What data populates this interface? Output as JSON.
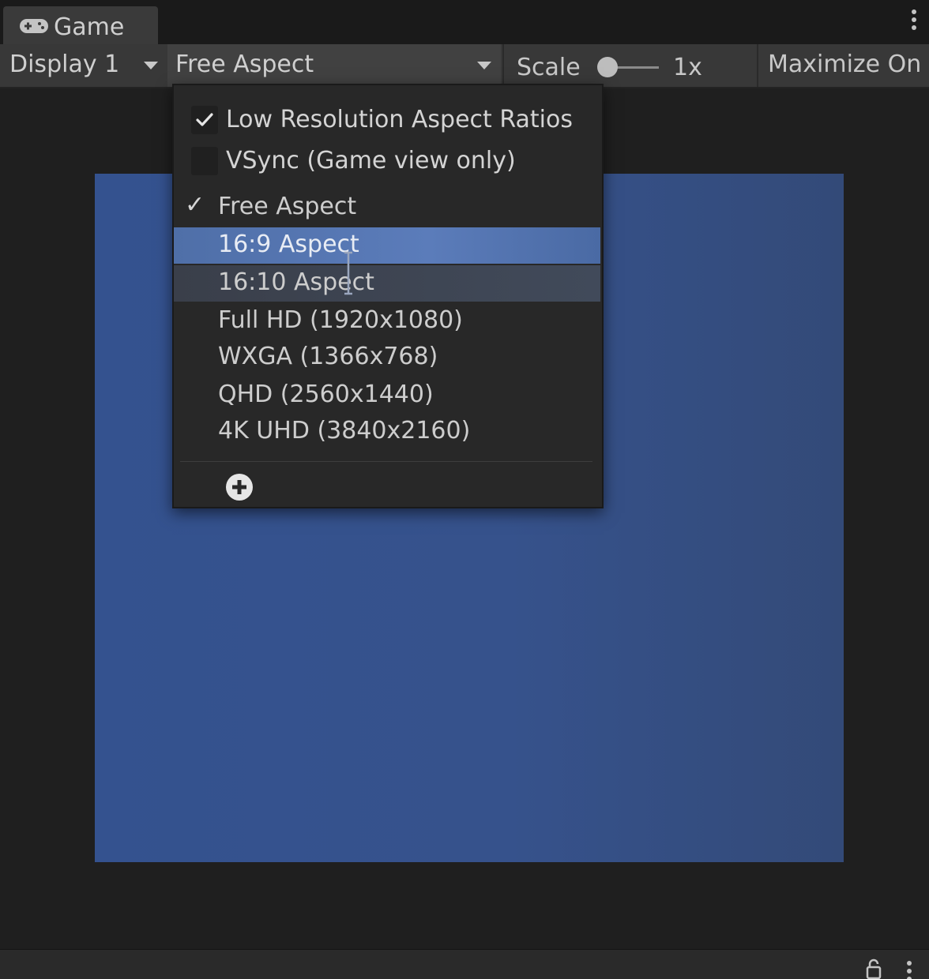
{
  "window": {
    "tab_label": "Game",
    "tab_icon": "gamepad-icon"
  },
  "toolbar": {
    "display_label": "Display 1",
    "aspect_label": "Free Aspect",
    "scale_label": "Scale",
    "scale_value": "1x",
    "scale_slider_fraction": 0.0,
    "maximize_label": "Maximize On"
  },
  "dropdown": {
    "options": [
      {
        "label": "Low Resolution Aspect Ratios",
        "checked": true
      },
      {
        "label": "VSync (Game view only)",
        "checked": false
      }
    ],
    "aspects": [
      {
        "label": "Free Aspect",
        "selected": true,
        "hovered": false
      },
      {
        "label": "16:9 Aspect",
        "selected": false,
        "hovered": true
      },
      {
        "label": "16:10 Aspect",
        "selected": false,
        "hovered": false
      },
      {
        "label": "Full HD (1920x1080)",
        "selected": false,
        "hovered": false
      },
      {
        "label": "WXGA (1366x768)",
        "selected": false,
        "hovered": false
      },
      {
        "label": "QHD (2560x1440)",
        "selected": false,
        "hovered": false
      },
      {
        "label": "4K UHD (3840x2160)",
        "selected": false,
        "hovered": false
      }
    ],
    "selected_mark": "✓",
    "add_icon": "plus-circle-icon"
  },
  "colors": {
    "game_background": "#34528f",
    "highlight": "#5b7cba"
  }
}
